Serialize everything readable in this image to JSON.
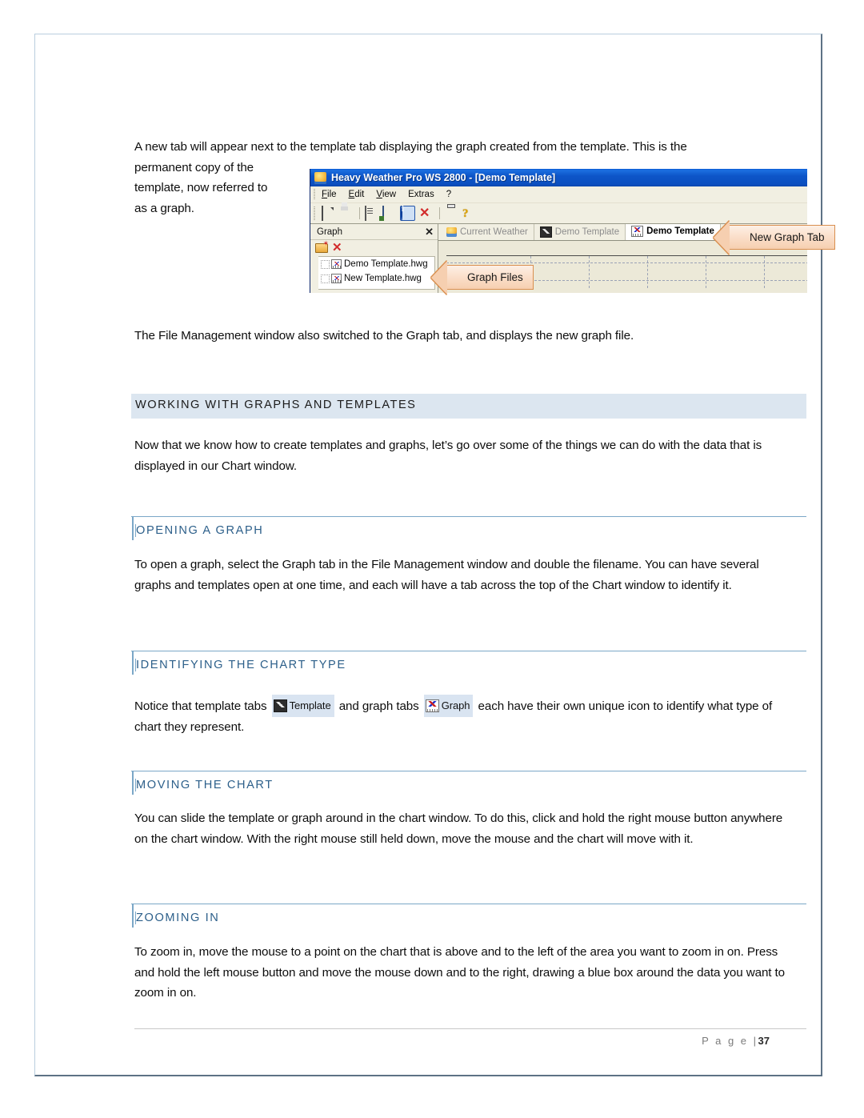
{
  "page": {
    "number": "37",
    "footer_prefix": "P a g e  |"
  },
  "paragraphs": {
    "intro_line1": "A new tab will appear next to the template tab displaying the graph created from the template. This is the",
    "intro_line2": "permanent copy of the",
    "intro_line3": "template, now referred to",
    "intro_line4": "as a graph.",
    "file_management": "The File Management window also switched to the Graph tab, and displays the new graph file."
  },
  "sections": [
    {
      "id": "working-with-graphs",
      "heading": "WORKING WITH GRAPHS AND TEMPLATES",
      "style": "band",
      "body": "Now that we know how to create templates and graphs, let’s go over some of the things we can do with the data that is displayed in our Chart window."
    },
    {
      "id": "opening-a-graph",
      "heading": "OPENING A GRAPH",
      "style": "rule",
      "body": "To open a graph, select the Graph tab in the File Management window and double the filename. You can have several graphs and templates open at one time, and each will have a tab across the top of the Chart window to identify it."
    },
    {
      "id": "identifying-the-chart-type",
      "heading": "IDENTIFYING THE CHART TYPE",
      "style": "rule",
      "body_part1": "Notice that template tabs",
      "chip1_label": "Template",
      "body_part2": "and graph tabs",
      "chip2_label": "Graph",
      "body_part3": "each have their own unique icon to identify what type of chart they represent."
    },
    {
      "id": "moving-the-chart",
      "heading": "MOVING THE CHART",
      "style": "rule",
      "body": "You can slide the template or graph around in the chart window. To do this, click and hold the right mouse button anywhere on the chart window. With the right mouse still held down, move the mouse and the chart will move with it."
    },
    {
      "id": "zooming-in",
      "heading": "ZOOMING IN",
      "style": "rule",
      "body": "To zoom in, move the mouse to a point on the chart that is above and to the left of the area you want to zoom in on. Press and hold the left mouse button and move the mouse down and to the right, drawing a blue box around the data you want to zoom in on."
    }
  ],
  "screenshot": {
    "title": "Heavy Weather Pro WS 2800 - [Demo Template]",
    "menu": [
      {
        "label": "File",
        "accel": "F"
      },
      {
        "label": "Edit",
        "accel": "E"
      },
      {
        "label": "View",
        "accel": "V"
      },
      {
        "label": "Extras",
        "accel": ""
      },
      {
        "label": "?",
        "accel": ""
      }
    ],
    "toolbar_icons": [
      "new-document-icon",
      "save-icon",
      "properties-icon",
      "device-settings-icon",
      "info-icon",
      "delete-icon",
      "print-icon",
      "help-icon"
    ],
    "file_panel": {
      "tab_title": "Graph",
      "close_label": "✕",
      "new_label": "new-folder-icon",
      "delete_label": "delete-icon",
      "files": [
        {
          "name": "Demo Template.hwg",
          "icon": "graph-file-icon"
        },
        {
          "name": "New Template.hwg",
          "icon": "graph-file-icon"
        }
      ]
    },
    "chart_tabs": [
      {
        "label": "Current Weather",
        "icon": "weather-icon",
        "selected": false
      },
      {
        "label": "Demo Template",
        "icon": "template-icon",
        "selected": false
      },
      {
        "label": "Demo Template",
        "icon": "graph-icon",
        "selected": true
      }
    ],
    "callouts": [
      {
        "id": "new-graph-tab",
        "text": "New Graph Tab"
      },
      {
        "id": "graph-files",
        "text": "Graph Files"
      }
    ]
  },
  "colors": {
    "band_bg": "#dce6f0",
    "heading_blue": "#2c5f8a",
    "rule_blue": "#7ba7c7",
    "page_border": "#b9cede",
    "titlebar_blue": "#0d55c8",
    "callout_fill": "#f6cfb0",
    "callout_border": "#d98f4f",
    "app_chrome": "#ece9d8"
  }
}
